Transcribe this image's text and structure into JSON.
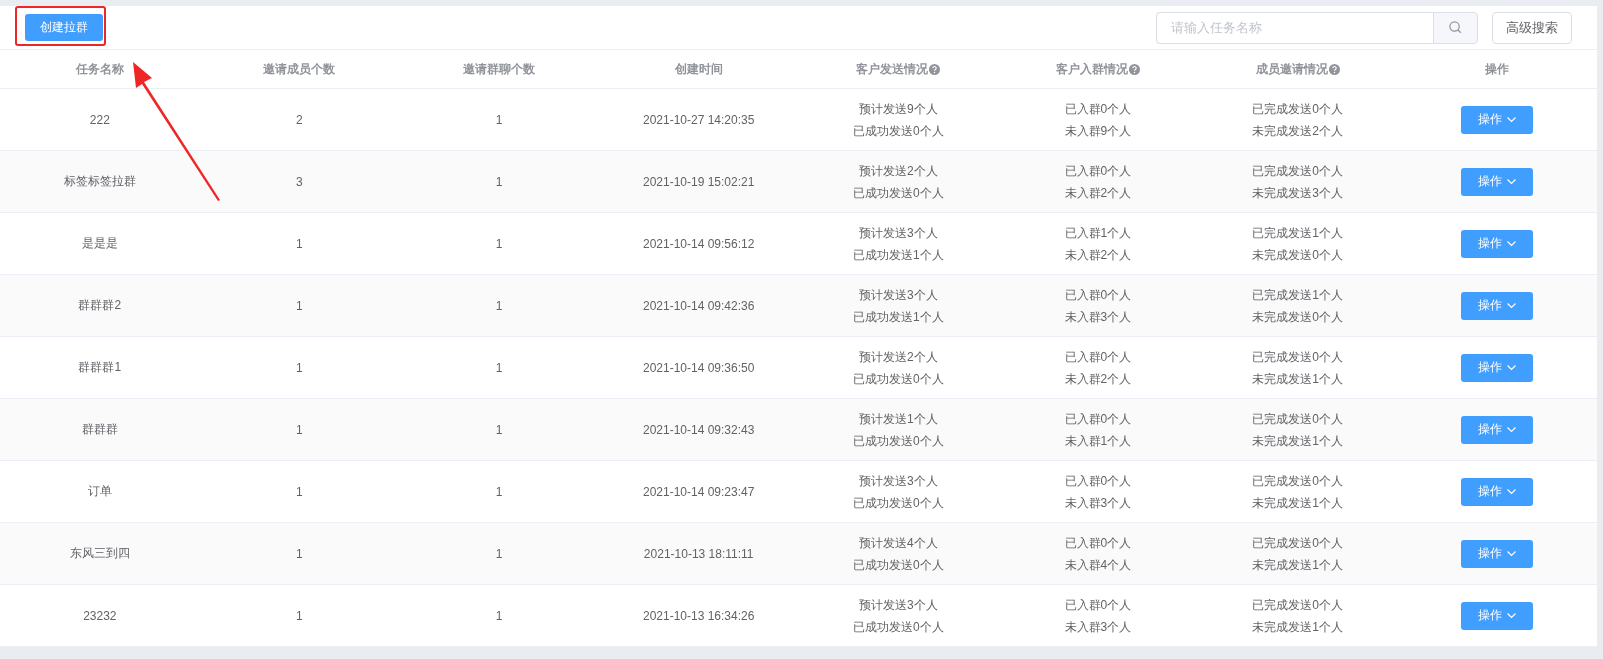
{
  "toolbar": {
    "create_button": "创建拉群",
    "search": {
      "placeholder": "请输入任务名称"
    },
    "advanced_search_button": "高级搜索"
  },
  "table": {
    "columns": [
      {
        "label": "任务名称",
        "help": false
      },
      {
        "label": "邀请成员个数",
        "help": false
      },
      {
        "label": "邀请群聊个数",
        "help": false
      },
      {
        "label": "创建时间",
        "help": false
      },
      {
        "label": "客户发送情况",
        "help": true
      },
      {
        "label": "客户入群情况",
        "help": true
      },
      {
        "label": "成员邀请情况",
        "help": true
      },
      {
        "label": "操作",
        "help": false
      }
    ],
    "rows": [
      {
        "name": "222",
        "members": "2",
        "groups": "1",
        "created": "2021-10-27 14:20:35",
        "send": [
          "预计发送9个人",
          "已成功发送0个人"
        ],
        "join": [
          "已入群0个人",
          "未入群9个人"
        ],
        "invite": [
          "已完成发送0个人",
          "未完成发送2个人"
        ],
        "action": "操作"
      },
      {
        "name": "标签标签拉群",
        "members": "3",
        "groups": "1",
        "created": "2021-10-19 15:02:21",
        "send": [
          "预计发送2个人",
          "已成功发送0个人"
        ],
        "join": [
          "已入群0个人",
          "未入群2个人"
        ],
        "invite": [
          "已完成发送0个人",
          "未完成发送3个人"
        ],
        "action": "操作"
      },
      {
        "name": "是是是",
        "members": "1",
        "groups": "1",
        "created": "2021-10-14 09:56:12",
        "send": [
          "预计发送3个人",
          "已成功发送1个人"
        ],
        "join": [
          "已入群1个人",
          "未入群2个人"
        ],
        "invite": [
          "已完成发送1个人",
          "未完成发送0个人"
        ],
        "action": "操作"
      },
      {
        "name": "群群群2",
        "members": "1",
        "groups": "1",
        "created": "2021-10-14 09:42:36",
        "send": [
          "预计发送3个人",
          "已成功发送1个人"
        ],
        "join": [
          "已入群0个人",
          "未入群3个人"
        ],
        "invite": [
          "已完成发送1个人",
          "未完成发送0个人"
        ],
        "action": "操作"
      },
      {
        "name": "群群群1",
        "members": "1",
        "groups": "1",
        "created": "2021-10-14 09:36:50",
        "send": [
          "预计发送2个人",
          "已成功发送0个人"
        ],
        "join": [
          "已入群0个人",
          "未入群2个人"
        ],
        "invite": [
          "已完成发送0个人",
          "未完成发送1个人"
        ],
        "action": "操作"
      },
      {
        "name": "群群群",
        "members": "1",
        "groups": "1",
        "created": "2021-10-14 09:32:43",
        "send": [
          "预计发送1个人",
          "已成功发送0个人"
        ],
        "join": [
          "已入群0个人",
          "未入群1个人"
        ],
        "invite": [
          "已完成发送0个人",
          "未完成发送1个人"
        ],
        "action": "操作"
      },
      {
        "name": "订单",
        "members": "1",
        "groups": "1",
        "created": "2021-10-14 09:23:47",
        "send": [
          "预计发送3个人",
          "已成功发送0个人"
        ],
        "join": [
          "已入群0个人",
          "未入群3个人"
        ],
        "invite": [
          "已完成发送0个人",
          "未完成发送1个人"
        ],
        "action": "操作"
      },
      {
        "name": "东风三到四",
        "members": "1",
        "groups": "1",
        "created": "2021-10-13 18:11:11",
        "send": [
          "预计发送4个人",
          "已成功发送0个人"
        ],
        "join": [
          "已入群0个人",
          "未入群4个人"
        ],
        "invite": [
          "已完成发送0个人",
          "未完成发送1个人"
        ],
        "action": "操作"
      },
      {
        "name": "23232",
        "members": "1",
        "groups": "1",
        "created": "2021-10-13 16:34:26",
        "send": [
          "预计发送3个人",
          "已成功发送0个人"
        ],
        "join": [
          "已入群0个人",
          "未入群3个人"
        ],
        "invite": [
          "已完成发送0个人",
          "未完成发送1个人"
        ],
        "action": "操作"
      }
    ]
  }
}
